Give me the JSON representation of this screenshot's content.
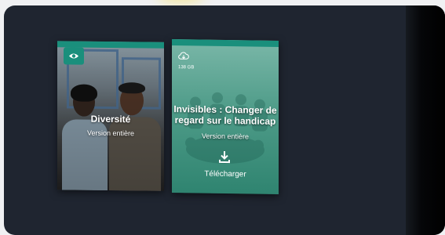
{
  "cards": [
    {
      "title": "Diversité",
      "subtitle": "Version entière",
      "badge_icon": "eye-icon"
    },
    {
      "title": "Invisibles : Changer de regard sur le handicap",
      "subtitle": "Version entière",
      "size": "138 GB",
      "size_icon": "cloud-download-icon",
      "action_icon": "download-icon",
      "action_label": "Télécharger"
    }
  ],
  "colors": {
    "panel": "#1f2530",
    "accent": "#1a8f7c"
  }
}
